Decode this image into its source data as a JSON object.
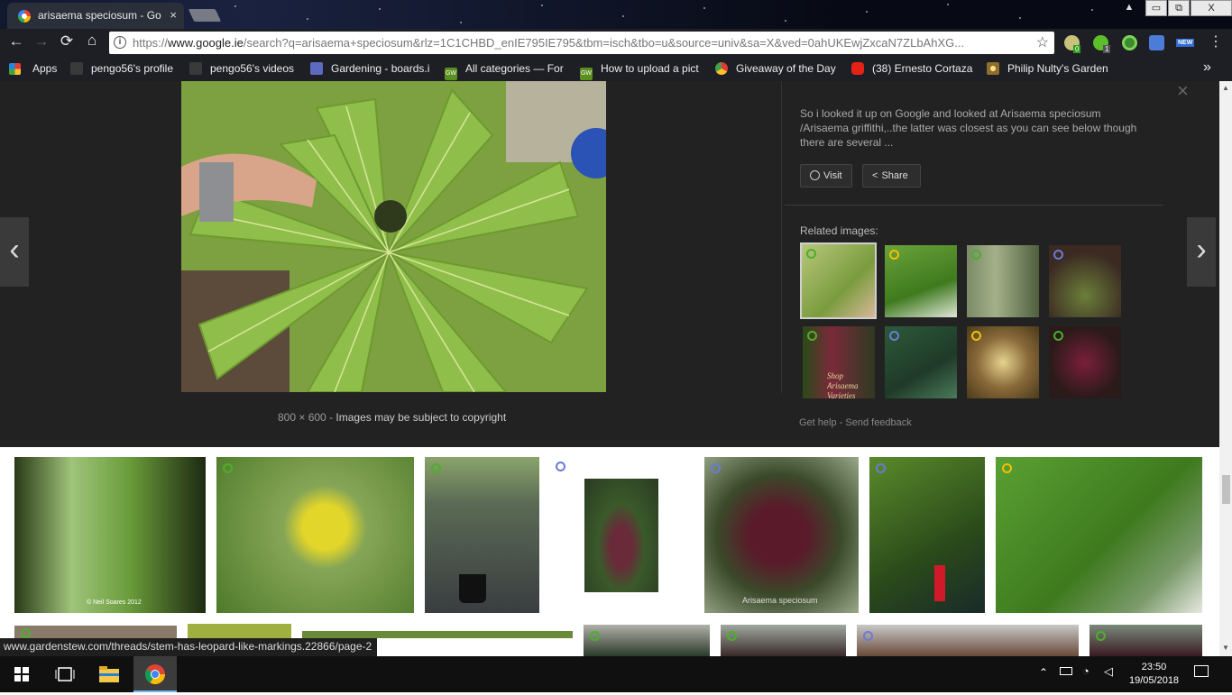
{
  "browser": {
    "tab_title": "arisaema speciosum - Go",
    "tab_close": "×",
    "window_controls": [
      "▭",
      "⧉",
      "X"
    ],
    "url_scheme": "https://",
    "url_host": "www.google.ie",
    "url_rest": "/search?q=arisaema+speciosum&rlz=1C1CHBD_enIE795IE795&tbm=isch&tbo=u&source=univ&sa=X&ved=0ahUKEwjZxcaN7ZLbAhXG...",
    "nav": {
      "back": "←",
      "forward": "→",
      "reload": "⟳",
      "home": "⌂"
    },
    "star": "☆",
    "extension_badges": [
      "0",
      "1"
    ],
    "ext_new_label": "NEW",
    "bookmarks": [
      {
        "label": "Apps",
        "icon": "apps-grid-icon"
      },
      {
        "label": "pengo56's profile",
        "icon": "gardening-icon"
      },
      {
        "label": "pengo56's videos",
        "icon": "gardening-icon"
      },
      {
        "label": "Gardening - boards.i",
        "icon": "boards-icon"
      },
      {
        "label": "All categories — For",
        "icon": "gw-icon"
      },
      {
        "label": "How to upload a pict",
        "icon": "gw-icon"
      },
      {
        "label": "Giveaway of the Day",
        "icon": "giveaway-icon"
      },
      {
        "label": "(38) Ernesto Cortaza",
        "icon": "youtube-icon"
      },
      {
        "label": "Philip Nulty's Garden",
        "icon": "flower-icon"
      }
    ],
    "bookmarks_more": "»",
    "gw_label": "GW"
  },
  "viewer": {
    "description": "So i looked it up on Google and looked at Arisaema speciosum /Arisaema griffithi,..the latter was closest as you can see below though there are several ...",
    "visit_label": "Visit",
    "share_label": "Share",
    "related_title": "Related images:",
    "dimensions": "800 × 600",
    "separator": "-",
    "copyright": "Images may be subject to copyright",
    "get_help": "Get help",
    "help_sep": "-",
    "send_feedback": "Send feedback",
    "prev": "‹",
    "next": "›",
    "close": "×",
    "related_watermark": "Shop Arisaema Varieties"
  },
  "results": {
    "watermark_1": "© Neil Soares 2012",
    "watermark_5": "Arisaema speciosum"
  },
  "status_url": "www.gardenstew.com/threads/stem-has-leopard-like-markings.22866/page-2",
  "taskbar": {
    "time": "23:50",
    "date": "19/05/2018"
  }
}
